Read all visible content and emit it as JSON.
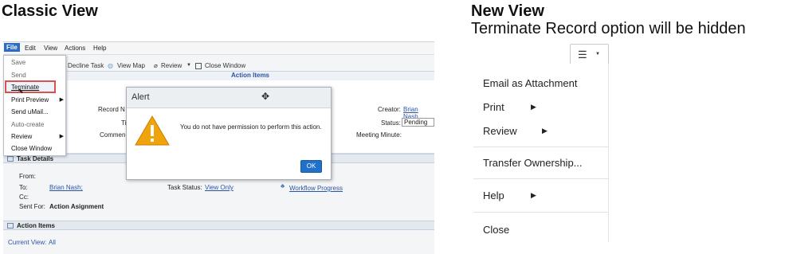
{
  "classic": {
    "heading": "Classic View",
    "menubar": [
      "File",
      "Edit",
      "View",
      "Actions",
      "Help"
    ],
    "toolbar": {
      "decline": "Decline Task",
      "view_map": "View Map",
      "review": "Review",
      "close_window": "Close Window"
    },
    "section_title": "Action Items",
    "form": {
      "record_label": "Record N",
      "title_label": "Titl",
      "comment_label": "Commen",
      "creator_label": "Creator:",
      "creator_value": "Brian Nash",
      "status_label": "Status:",
      "status_value": "Pending",
      "meeting_label": "Meeting Minute:"
    },
    "task_details": {
      "heading": "Task Details",
      "from_label": "From:",
      "to_label": "To:",
      "to_value": "Brian Nash;",
      "cc_label": "Cc:",
      "sent_label": "Sent For:",
      "sent_value": "Action Asignment",
      "status_label": "Task Status:",
      "status_value": "View Only",
      "workflow_link": "Workflow Progress"
    },
    "action_items": {
      "heading": "Action Items",
      "current_view_label": "Current View:",
      "current_view_value": "All"
    },
    "file_menu": {
      "items": [
        {
          "label": "Save",
          "enabled": false
        },
        {
          "label": "Send",
          "enabled": false
        },
        {
          "label": "Terminate",
          "enabled": true,
          "highlighted": true
        },
        {
          "label": "Print Preview",
          "enabled": true,
          "submenu": true
        },
        {
          "label": "Send uMail...",
          "enabled": true
        },
        {
          "label": "Auto-create",
          "enabled": false
        },
        {
          "label": "Review",
          "enabled": true,
          "submenu": true
        },
        {
          "label": "Close Window",
          "enabled": true
        }
      ]
    },
    "alert": {
      "title": "Alert",
      "message": "You do not have permission to perform this action.",
      "ok_label": "OK"
    }
  },
  "new_view": {
    "heading": "New View",
    "subheading": "Terminate Record option will be hidden",
    "menu_items": [
      {
        "label": "Email as Attachment",
        "submenu": false
      },
      {
        "label": "Print",
        "submenu": true
      },
      {
        "label": "Review",
        "submenu": true
      },
      {
        "label": "Transfer Ownership...",
        "submenu": false
      },
      {
        "label": "Help",
        "submenu": true
      },
      {
        "label": "Close",
        "submenu": false
      }
    ]
  },
  "colors": {
    "highlight_border": "#d9534f",
    "accent_blue": "#1f71c9",
    "warning_yellow": "#f0a30a"
  }
}
